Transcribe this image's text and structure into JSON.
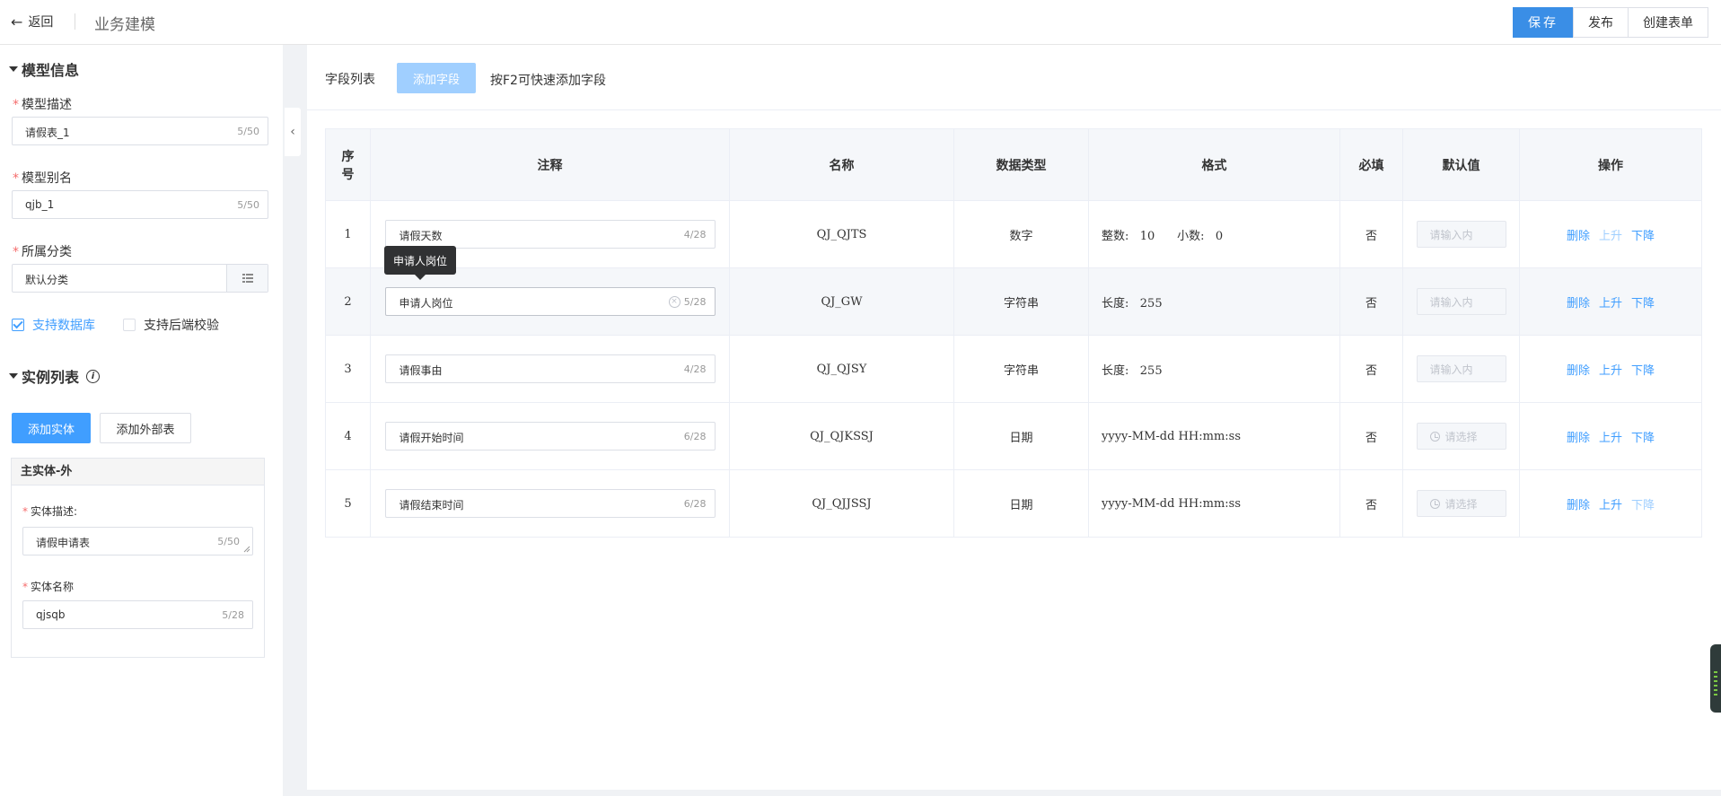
{
  "header": {
    "back_label": "返回",
    "title": "业务建模",
    "save_label": "保存",
    "publish_label": "发布",
    "create_form_label": "创建表单"
  },
  "model_info": {
    "section_title": "模型信息",
    "desc_label": "模型描述",
    "desc_value": "请假表_1",
    "desc_count": "5/50",
    "alias_label": "模型别名",
    "alias_value": "qjb_1",
    "alias_count": "5/50",
    "category_label": "所属分类",
    "category_value": "默认分类",
    "support_db_label": "支持数据库",
    "support_db_checked": true,
    "support_backend_label": "支持后端校验",
    "support_backend_checked": false
  },
  "instances": {
    "section_title": "实例列表",
    "add_entity_label": "添加实体",
    "add_external_label": "添加外部表",
    "card_title": "主实体-外",
    "entity_desc_label": "实体描述:",
    "entity_desc_value": "请假申请表",
    "entity_desc_count": "5/50",
    "entity_name_label": "实体名称",
    "entity_name_value": "qjsqb",
    "entity_name_count": "5/28"
  },
  "fields": {
    "title": "字段列表",
    "add_field_label": "添加字段",
    "hint": "按F2可快速添加字段",
    "columns": [
      "序号",
      "注释",
      "名称",
      "数据类型",
      "格式",
      "必填",
      "默认值",
      "操作"
    ],
    "col_index_line1": "序",
    "col_index_line2": "号",
    "tooltip": "申请人岗位",
    "rows": [
      {
        "index": "1",
        "comment": "请假天数",
        "count": "4/28",
        "name": "QJ_QJTS",
        "type": "数字",
        "format": "整数:   10      小数:   0",
        "required": "否",
        "default": "请输入内",
        "del": "删除",
        "up": "上升",
        "down": "下降"
      },
      {
        "index": "2",
        "comment": "申请人岗位",
        "count": "5/28",
        "name": "QJ_GW",
        "type": "字符串",
        "format": "长度:   255",
        "required": "否",
        "default": "请输入内",
        "del": "删除",
        "up": "上升",
        "down": "下降"
      },
      {
        "index": "3",
        "comment": "请假事由",
        "count": "4/28",
        "name": "QJ_QJSY",
        "type": "字符串",
        "format": "长度:   255",
        "required": "否",
        "default": "请输入内",
        "del": "删除",
        "up": "上升",
        "down": "下降"
      },
      {
        "index": "4",
        "comment": "请假开始时间",
        "count": "6/28",
        "name": "QJ_QJKSSJ",
        "type": "日期",
        "format": "yyyy-MM-dd HH:mm:ss",
        "required": "否",
        "default": "请选择",
        "del": "删除",
        "up": "上升",
        "down": "下降"
      },
      {
        "index": "5",
        "comment": "请假结束时间",
        "count": "6/28",
        "name": "QJ_QJJSSJ",
        "type": "日期",
        "format": "yyyy-MM-dd HH:mm:ss",
        "required": "否",
        "default": "请选择",
        "del": "删除",
        "up": "上升",
        "down": "下降"
      }
    ]
  },
  "colors": {
    "primary": "#409eff",
    "primary_light": "#a0cfff",
    "required": "#f56c6c"
  }
}
